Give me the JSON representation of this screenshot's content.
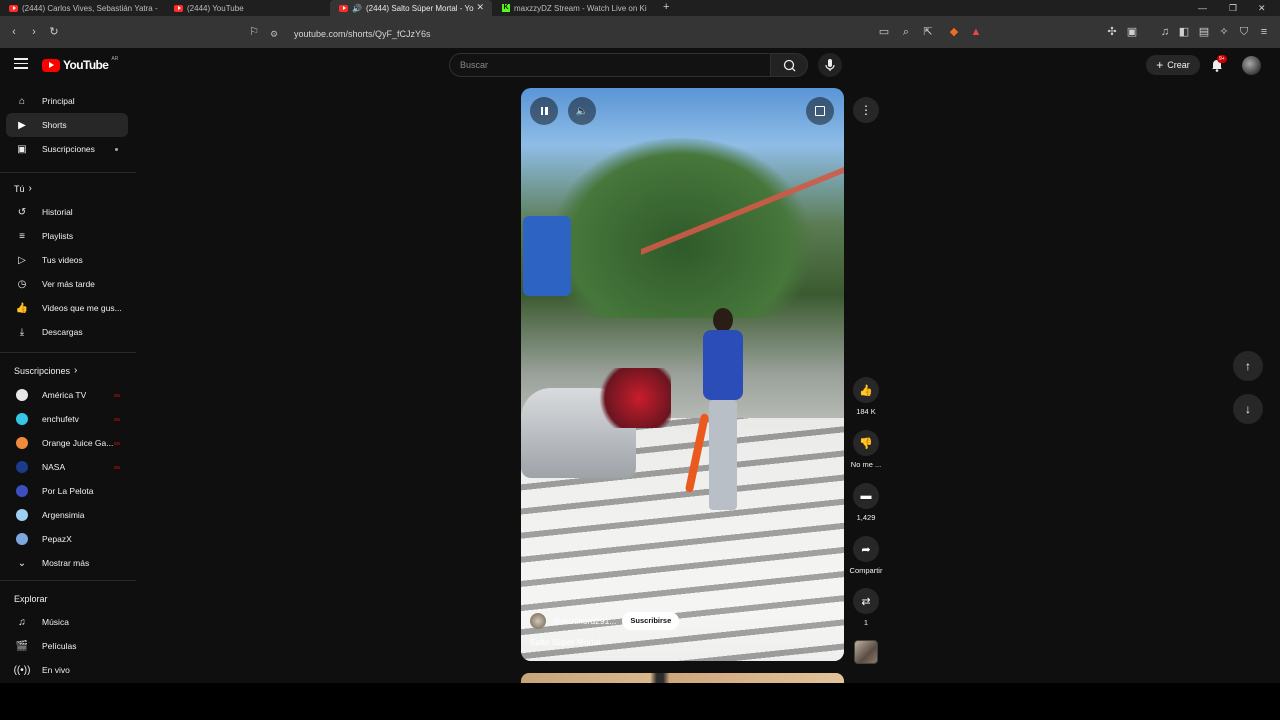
{
  "browser": {
    "tabs": [
      {
        "title": "(2444) Carlos Vives, Sebastián Yatra -",
        "favicon": "youtube-favicon"
      },
      {
        "title": "(2444) YouTube",
        "favicon": "youtube-favicon"
      },
      {
        "title": "(2444) Salto Súper Mortal - Yo",
        "favicon": "youtube-favicon",
        "audio": true,
        "active": true
      },
      {
        "title": "maxzzyDZ Stream - Watch Live on Ki",
        "favicon": "kick-favicon"
      }
    ],
    "url": "youtube.com/shorts/QyF_fCJzY6s"
  },
  "masthead": {
    "logo_text": "YouTube",
    "region": "AR",
    "search_placeholder": "Buscar",
    "create_label": "Crear",
    "notif_count": "9+"
  },
  "sidebar": {
    "main": [
      {
        "label": "Principal",
        "icon": "home-icon"
      },
      {
        "label": "Shorts",
        "icon": "shorts-icon",
        "active": true
      },
      {
        "label": "Suscripciones",
        "icon": "subscriptions-icon"
      }
    ],
    "you_header": "Tú",
    "you": [
      {
        "label": "Historial",
        "icon": "history-icon"
      },
      {
        "label": "Playlists",
        "icon": "playlists-icon"
      },
      {
        "label": "Tus videos",
        "icon": "your-videos-icon"
      },
      {
        "label": "Ver más tarde",
        "icon": "watch-later-icon"
      },
      {
        "label": "Videos que me gus...",
        "icon": "liked-icon"
      },
      {
        "label": "Descargas",
        "icon": "downloads-icon"
      }
    ],
    "subs_header": "Suscripciones",
    "subscriptions": [
      {
        "label": "América TV",
        "color": "#e8e8e8"
      },
      {
        "label": "enchufetv",
        "color": "#36c6e8"
      },
      {
        "label": "Orange Juice Ga...",
        "color": "#f08a3c"
      },
      {
        "label": "NASA",
        "color": "#1b3a8c"
      },
      {
        "label": "Por La Pelota",
        "color": "#3b4fbf"
      },
      {
        "label": "Argensimia",
        "color": "#9fd0f2"
      },
      {
        "label": "PepazX",
        "color": "#7ea7e0"
      }
    ],
    "show_more": "Mostrar más",
    "explore_header": "Explorar",
    "explore": [
      {
        "label": "Música",
        "icon": "music-icon"
      },
      {
        "label": "Películas",
        "icon": "movies-icon"
      },
      {
        "label": "En vivo",
        "icon": "live-icon"
      }
    ]
  },
  "short": {
    "channel": "@elchinord291...",
    "subscribe_label": "Suscribirse",
    "title": "Salto Súper Mortal"
  },
  "actions": {
    "likes": "184 K",
    "dislike_label": "No me ...",
    "comments": "1,429",
    "share_label": "Compartir",
    "remix_count": "1"
  }
}
